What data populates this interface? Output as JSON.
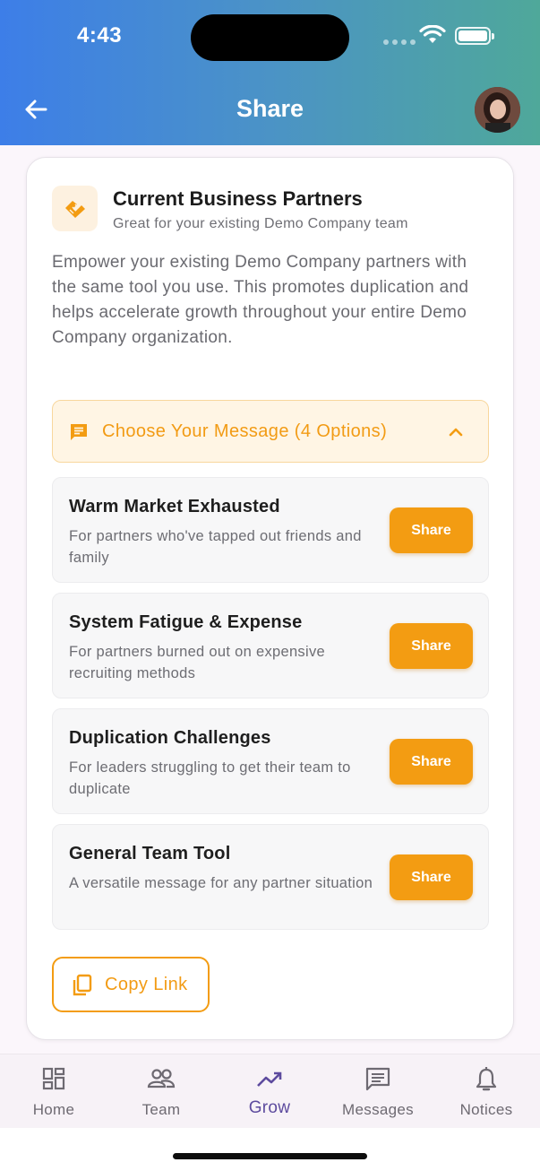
{
  "status_bar": {
    "time": "4:43"
  },
  "header": {
    "title": "Share",
    "back_icon": "arrow-left-icon",
    "avatar_icon": "user-avatar"
  },
  "card": {
    "icon": "handshake-icon",
    "title": "Current Business Partners",
    "subtitle": "Great for your existing Demo Company team",
    "description": "Empower your existing Demo Company partners with the same tool you use. This promotes duplication and helps accelerate growth throughout your entire Demo Company organization.",
    "chooser": {
      "icon": "message-icon",
      "label": "Choose Your Message (4 Options)",
      "expanded_icon": "chevron-up-icon"
    },
    "options": [
      {
        "title": "Warm Market Exhausted",
        "description": "For partners who've tapped out friends and family",
        "button": "Share"
      },
      {
        "title": "System Fatigue & Expense",
        "description": "For partners burned out on expensive recruiting methods",
        "button": "Share"
      },
      {
        "title": "Duplication Challenges",
        "description": "For leaders struggling to get their team to duplicate",
        "button": "Share"
      },
      {
        "title": "General Team Tool",
        "description": "A versatile message for any partner situation",
        "button": "Share"
      }
    ],
    "copy_link": {
      "icon": "copy-icon",
      "label": "Copy Link"
    }
  },
  "bottom_nav": [
    {
      "label": "Home",
      "icon": "dashboard-icon",
      "active": false
    },
    {
      "label": "Team",
      "icon": "people-icon",
      "active": false
    },
    {
      "label": "Grow",
      "icon": "trending-up-icon",
      "active": true
    },
    {
      "label": "Messages",
      "icon": "chat-icon",
      "active": false
    },
    {
      "label": "Notices",
      "icon": "bell-icon",
      "active": false
    }
  ],
  "colors": {
    "accent": "#f39c12",
    "header_start": "#3d7ee8",
    "header_end": "#4fa89a",
    "active_nav": "#5d4b9e"
  }
}
